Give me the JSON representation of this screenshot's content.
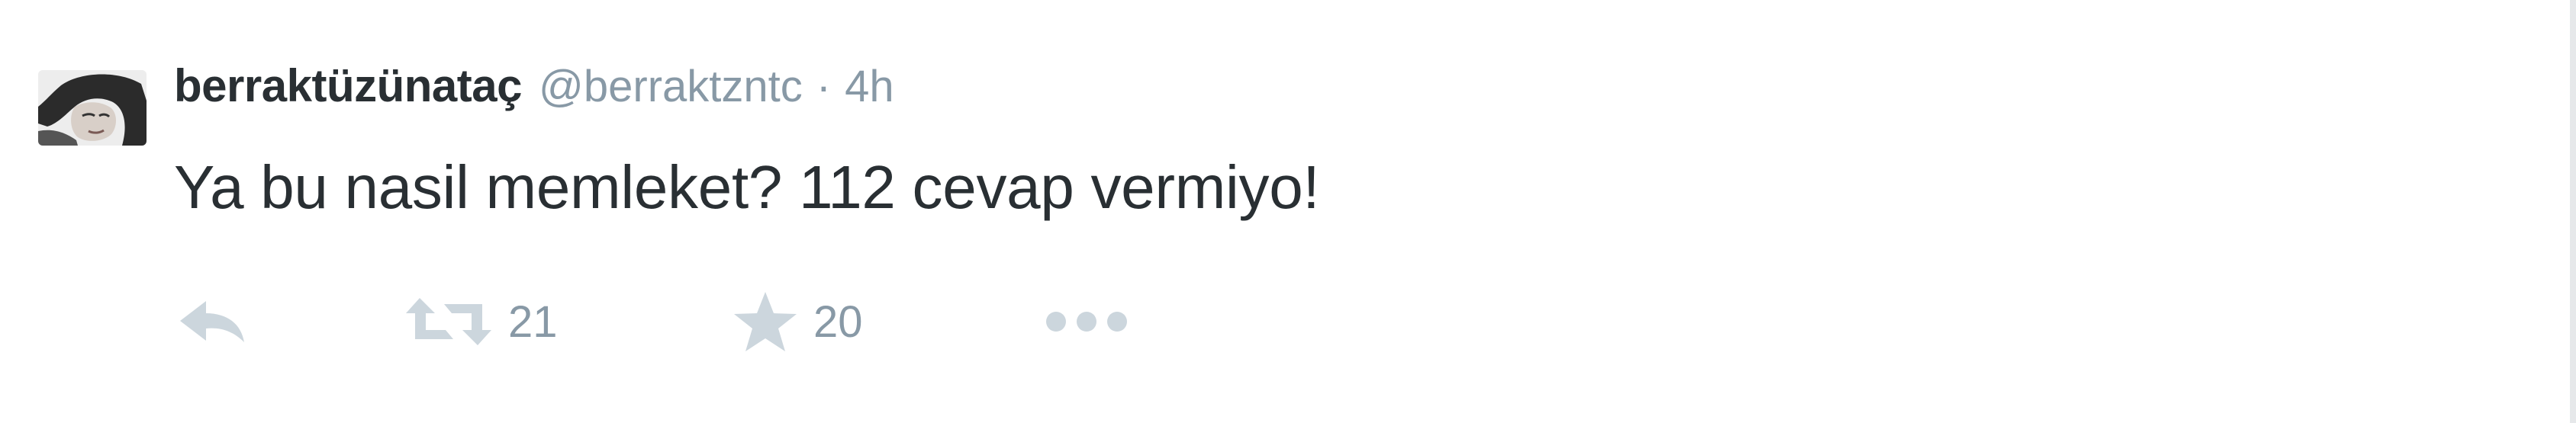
{
  "tweet": {
    "fullname": "berraktüzünataç",
    "screen_name": "@berraktzntc",
    "separator": "·",
    "timestamp": "4h",
    "text": "Ya bu nasil memleket? 112 cevap vermiyo!"
  },
  "actions": {
    "reply_icon": "reply-icon",
    "retweet_icon": "retweet-icon",
    "retweet_count": "21",
    "favorite_icon": "star-icon",
    "favorite_count": "20",
    "more_icon": "more-dots-icon"
  },
  "colors": {
    "name": "#292f33",
    "muted": "#8899a6",
    "icon": "#ccd6dd",
    "background": "#ffffff"
  }
}
